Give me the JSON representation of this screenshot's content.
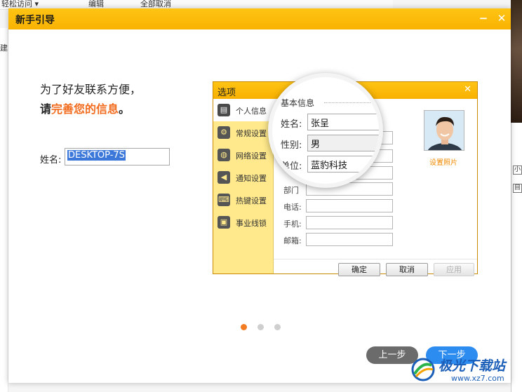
{
  "background_app": {
    "toolbar_items": [
      "轻松访问 ▾",
      "编辑",
      "全部取消"
    ],
    "left_label": "建",
    "right_boxes": [
      "小",
      "目"
    ]
  },
  "dialog": {
    "title": "新手引导",
    "minimize_glyph": "−",
    "close_glyph": "✕",
    "intro_line1": "为了好友联系方便，",
    "intro_line2_prefix": "请",
    "intro_line2_highlight": "完善您的信息",
    "intro_line2_suffix": "。",
    "name_label": "姓名:",
    "name_value": "DESKTOP-7S",
    "prev_button": "上一步",
    "next_button": "下一步",
    "pagination": {
      "total": 3,
      "active_index": 0
    }
  },
  "illustration": {
    "window_title": "选项",
    "close_glyph": "✕",
    "nav": [
      {
        "label": "个人信息",
        "icon": "id-card-icon",
        "glyph": "▤",
        "active": true
      },
      {
        "label": "常规设置",
        "icon": "gear-icon",
        "glyph": "⚙",
        "active": false
      },
      {
        "label": "网络设置",
        "icon": "globe-icon",
        "glyph": "◍",
        "active": false
      },
      {
        "label": "通知设置",
        "icon": "speaker-icon",
        "glyph": "◀",
        "active": false
      },
      {
        "label": "热键设置",
        "icon": "keyboard-icon",
        "glyph": "⌨",
        "active": false
      },
      {
        "label": "事业线锁",
        "icon": "lock-icon",
        "glyph": "▣",
        "active": false
      }
    ],
    "form_labels": {
      "dept": "部门",
      "phone": "电话:",
      "mobile": "手机:",
      "email": "邮箱:"
    },
    "buttons": {
      "ok": "确定",
      "cancel": "取消",
      "apply": "应用"
    },
    "avatar_link": "设置照片",
    "magnifier": {
      "section": "基本信息",
      "name_label": "姓名:",
      "name_value": "张呈",
      "gender_label": "性别:",
      "gender_value": "男",
      "company_label": "单位:",
      "company_value": "蓝豹科技"
    }
  },
  "watermark": {
    "text": "极光下载站",
    "url": "www.xz7.com"
  },
  "colors": {
    "title_bar": "#f9b200",
    "highlight": "#f26b1d",
    "next_button": "#2d8cf0",
    "prev_button": "#6b6b6b",
    "active_dot": "#f37b22"
  }
}
